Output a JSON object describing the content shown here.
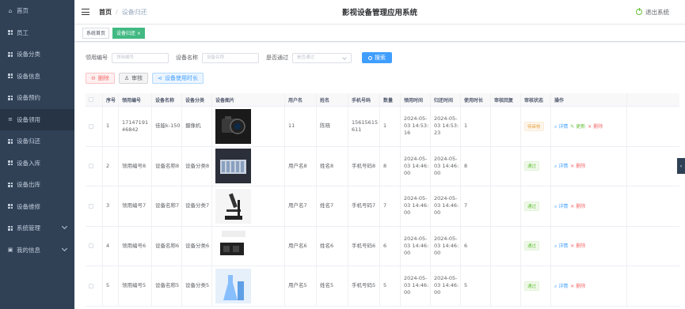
{
  "sidebar": {
    "items": [
      {
        "label": "首页",
        "icon": "home-icon"
      },
      {
        "label": "员工",
        "icon": "grid-icon"
      },
      {
        "label": "设备分类",
        "icon": "grid-icon"
      },
      {
        "label": "设备信息",
        "icon": "grid-icon"
      },
      {
        "label": "设备预约",
        "icon": "grid-icon"
      },
      {
        "label": "设备领用",
        "icon": "list-icon"
      },
      {
        "label": "设备归还",
        "icon": "grid-icon"
      },
      {
        "label": "设备入库",
        "icon": "grid-icon"
      },
      {
        "label": "设备出库",
        "icon": "grid-icon"
      },
      {
        "label": "设备维修",
        "icon": "grid-icon"
      },
      {
        "label": "系统管理",
        "icon": "grid-icon"
      },
      {
        "label": "我的信息",
        "icon": "user-card-icon"
      }
    ]
  },
  "header": {
    "breadcrumb_home": "首页",
    "breadcrumb_sep": "/",
    "breadcrumb_current": "设备归还",
    "system_title": "影视设备管理应用系统",
    "logout_label": "退出系统"
  },
  "tags": {
    "home": "系统首页",
    "current": "设备归还 ×"
  },
  "search": {
    "code_label": "领用编号",
    "code_placeholder": "领用编号",
    "name_label": "设备名称",
    "name_placeholder": "设备名称",
    "pass_label": "是否通过",
    "pass_placeholder": "是否通过",
    "search_button": "搜索"
  },
  "actions": {
    "delete": "删除",
    "audit": "审核",
    "usage_time": "设备使用时长"
  },
  "table": {
    "headers": [
      "序号",
      "领用编号",
      "设备名称",
      "设备分类",
      "设备图片",
      "用户名",
      "姓名",
      "手机号码",
      "数量",
      "领用时间",
      "归还时间",
      "使用时长",
      "审核回复",
      "审核状态",
      "操作"
    ],
    "rows": [
      {
        "idx": "1",
        "code": "1714719146842",
        "name": "佳能k-150",
        "cat": "摄像机",
        "user": "11",
        "realname": "陈晓",
        "phone": "15615615611",
        "qty": "1",
        "borrow": "2024-05-03 14:53:16",
        "ret": "2024-05-03 14:53:23",
        "dur": "1",
        "reply": "",
        "status": "待审核",
        "status_type": "pending",
        "ops": [
          "详情",
          "更新",
          "删除"
        ]
      },
      {
        "idx": "2",
        "code": "领用编号8",
        "name": "设备名称8",
        "cat": "设备分类8",
        "user": "用户名8",
        "realname": "姓名8",
        "phone": "手机号码8",
        "qty": "8",
        "borrow": "2024-05-03 14:46:00",
        "ret": "2024-05-03 14:46:00",
        "dur": "8",
        "reply": "",
        "status": "通过",
        "status_type": "pass",
        "ops": [
          "详情",
          "删除"
        ]
      },
      {
        "idx": "3",
        "code": "领用编号7",
        "name": "设备名称7",
        "cat": "设备分类7",
        "user": "用户名7",
        "realname": "姓名7",
        "phone": "手机号码7",
        "qty": "7",
        "borrow": "2024-05-03 14:46:00",
        "ret": "2024-05-03 14:46:00",
        "dur": "7",
        "reply": "",
        "status": "通过",
        "status_type": "pass",
        "ops": [
          "详情",
          "删除"
        ]
      },
      {
        "idx": "4",
        "code": "领用编号6",
        "name": "设备名称6",
        "cat": "设备分类6",
        "user": "用户名6",
        "realname": "姓名6",
        "phone": "手机号码6",
        "qty": "6",
        "borrow": "2024-05-03 14:46:00",
        "ret": "2024-05-03 14:46:00",
        "dur": "6",
        "reply": "",
        "status": "通过",
        "status_type": "pass",
        "ops": [
          "详情",
          "删除"
        ]
      },
      {
        "idx": "5",
        "code": "领用编号5",
        "name": "设备名称5",
        "cat": "设备分类5",
        "user": "用户名5",
        "realname": "姓名5",
        "phone": "手机号码5",
        "qty": "5",
        "borrow": "2024-05-03 14:46:00",
        "ret": "2024-05-03 14:46:00",
        "dur": "5",
        "reply": "",
        "status": "通过",
        "status_type": "pass",
        "ops": [
          "详情",
          "删除"
        ]
      }
    ]
  },
  "colors": {
    "sidebar_bg": "#304156",
    "primary": "#409eff",
    "tag_active": "#42b983",
    "danger": "#f56c6c",
    "success": "#67c23a",
    "warning": "#e6a23c"
  }
}
